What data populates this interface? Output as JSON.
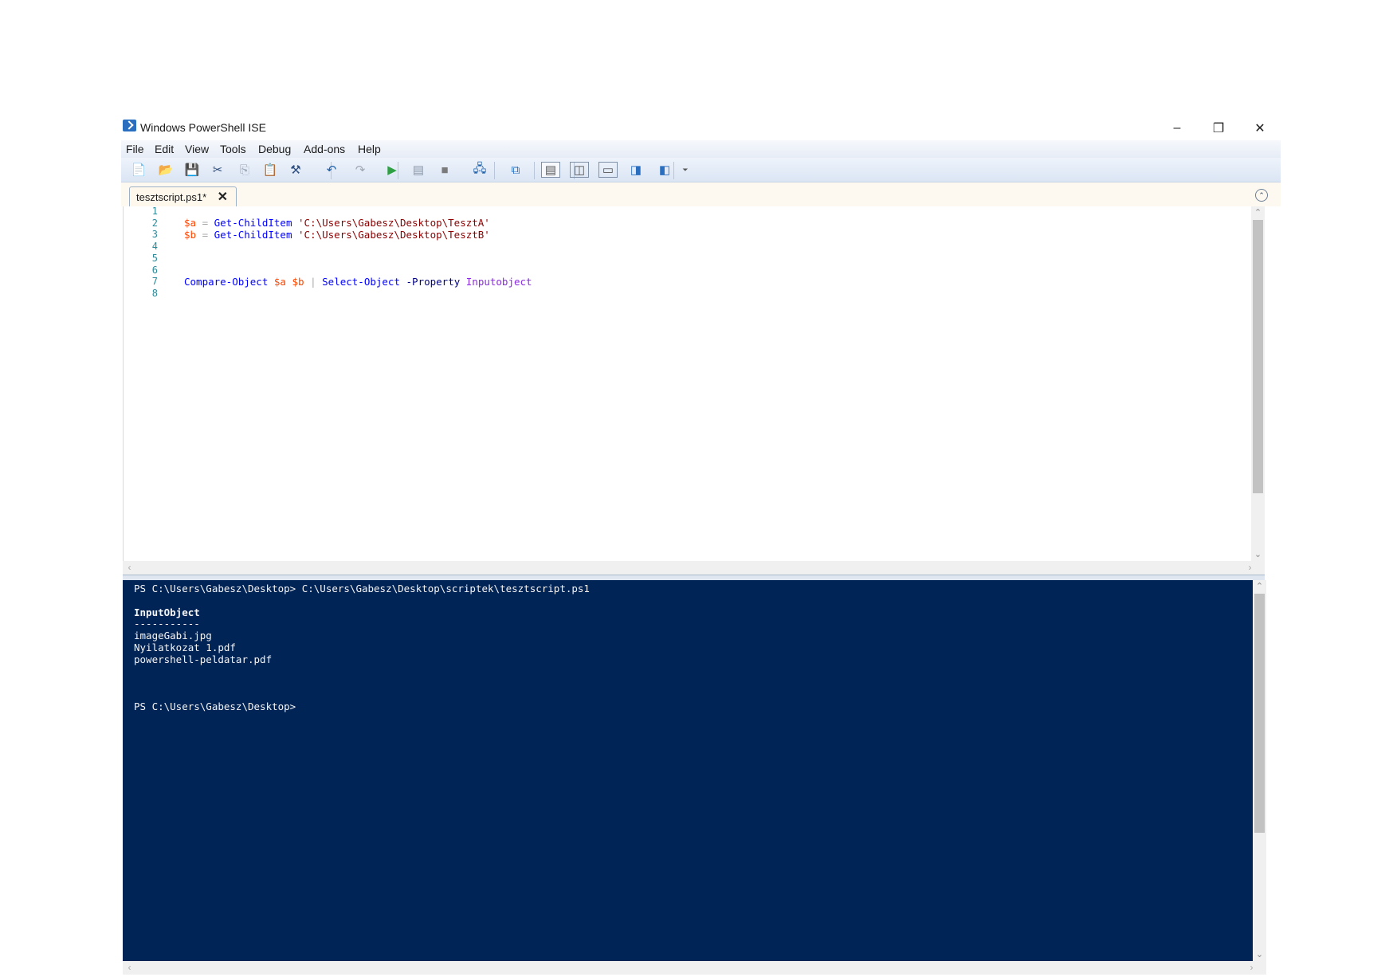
{
  "window": {
    "title": "Windows PowerShell ISE",
    "minimize_glyph": "–",
    "maximize_glyph": "❐",
    "close_glyph": "✕"
  },
  "menu": [
    "File",
    "Edit",
    "View",
    "Tools",
    "Debug",
    "Add-ons",
    "Help"
  ],
  "toolbar": {
    "buttons": [
      {
        "name": "new-script-icon",
        "glyph": "📄",
        "color": "#5f7fa8"
      },
      {
        "name": "open-icon",
        "glyph": "📂",
        "color": "#d6a53b"
      },
      {
        "name": "save-icon",
        "glyph": "💾",
        "color": "#1d5fa8"
      },
      {
        "name": "cut-icon",
        "glyph": "✂",
        "color": "#2f4f7f"
      },
      {
        "name": "copy-icon",
        "glyph": "⎘",
        "color": "#9aa5b5"
      },
      {
        "name": "paste-icon",
        "glyph": "📋",
        "color": "#4a4a4a"
      },
      {
        "name": "clear-console-icon",
        "glyph": "⚒",
        "color": "#2f4f7f"
      },
      {
        "name": "undo-icon",
        "glyph": "↶",
        "color": "#1d5fa8"
      },
      {
        "name": "redo-icon",
        "glyph": "↷",
        "color": "#a0a8b5"
      },
      {
        "name": "run-script-icon",
        "glyph": "▶",
        "color": "#2ea043"
      },
      {
        "name": "run-selection-icon",
        "glyph": "▤",
        "color": "#8a96a8"
      },
      {
        "name": "stop-icon",
        "glyph": "■",
        "color": "#7a7a7a"
      },
      {
        "name": "remote-powershell-icon",
        "glyph": "🖧",
        "color": "#1d5fa8"
      },
      {
        "name": "start-powershell-icon",
        "glyph": "⧉",
        "color": "#2a6fbf"
      },
      {
        "name": "show-script-pane-top-icon",
        "glyph": "▤",
        "color": "#555"
      },
      {
        "name": "show-script-pane-right-icon",
        "glyph": "◫",
        "color": "#555"
      },
      {
        "name": "show-script-pane-maximized-icon",
        "glyph": "▭",
        "color": "#555"
      },
      {
        "name": "show-command-window-icon",
        "glyph": "◨",
        "color": "#2a6fbf"
      },
      {
        "name": "show-command-addon-icon",
        "glyph": "◧",
        "color": "#2a6fbf"
      },
      {
        "name": "toolbar-overflow-icon",
        "glyph": "⏷",
        "color": "#555"
      }
    ]
  },
  "tab": {
    "label": "tesztscript.ps1*",
    "close_glyph": "✕",
    "collapse_glyph": "⌃"
  },
  "editor": {
    "line_numbers": [
      "1",
      "2",
      "3",
      "4",
      "5",
      "6",
      "7",
      "8"
    ]
  },
  "console": {
    "lines": [
      "PS C:\\Users\\Gabesz\\Desktop> C:\\Users\\Gabesz\\Desktop\\scriptek\\tesztscript.ps1",
      "",
      "InputObject",
      "-----------",
      "imageGabi.jpg",
      "Nyilatkozat 1.pdf",
      "powershell-peldatar.pdf",
      "",
      "",
      "",
      "PS C:\\Users\\Gabesz\\Desktop>"
    ]
  },
  "colors": {
    "console_bg": "#012456",
    "variable": "#ff4500",
    "command": "#0000ff",
    "string": "#8b0000",
    "parameter": "#000080",
    "argument": "#8a2be2"
  }
}
